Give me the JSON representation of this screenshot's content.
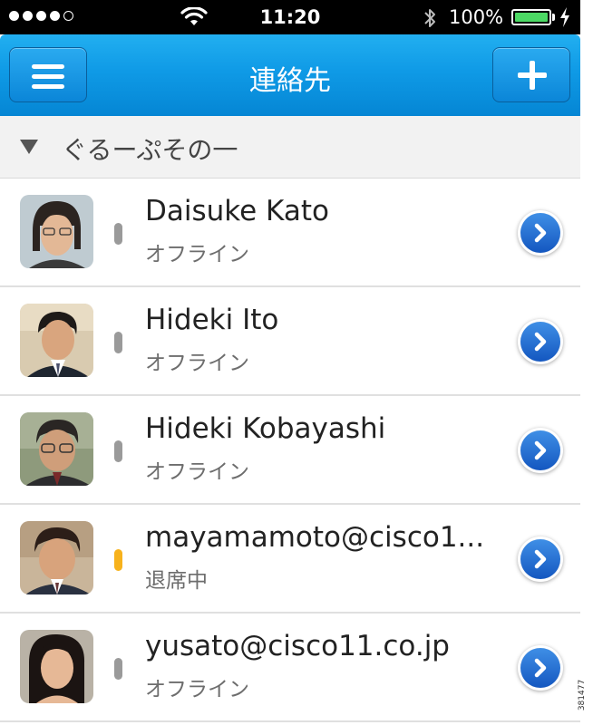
{
  "status_bar": {
    "time": "11:20",
    "battery": "100%",
    "signal_bars": 4,
    "signal_total": 5
  },
  "nav": {
    "title": "連絡先",
    "menu_icon": "hamburger-menu-icon",
    "add_icon": "plus-icon"
  },
  "group": {
    "name": "ぐるーぷその一",
    "expanded": true
  },
  "contacts": [
    {
      "name": "Daisuke Kato",
      "status": "オフライン",
      "presence": "offline"
    },
    {
      "name": "Hideki Ito",
      "status": "オフライン",
      "presence": "offline"
    },
    {
      "name": "Hideki Kobayashi",
      "status": "オフライン",
      "presence": "offline"
    },
    {
      "name": "mayamamoto@cisco1...",
      "status": "退席中",
      "presence": "away"
    },
    {
      "name": "yusato@cisco11.co.jp",
      "status": "オフライン",
      "presence": "offline"
    }
  ],
  "colors": {
    "nav_blue": "#0f9ae6",
    "presence_offline": "#9a9a9a",
    "presence_away": "#f7b21c",
    "battery_green": "#4cd964",
    "chevron_blue": "#1e6fd6"
  },
  "side_code": "381477"
}
